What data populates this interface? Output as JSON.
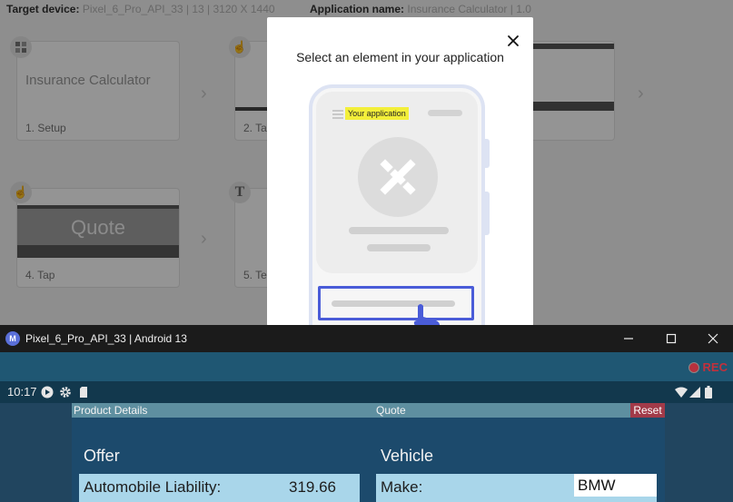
{
  "background": {
    "target_device_label": "Target device:",
    "target_device_value": "Pixel_6_Pro_API_33 | 13 | 3120 X 1440",
    "app_name_label": "Application name:",
    "app_name_value": "Insurance Calculator | 1.0",
    "cards": [
      {
        "caption": "1. Setup",
        "content": "Insurance Calculator"
      },
      {
        "caption": "2. Ta"
      },
      {
        "caption": "4. Tap",
        "content": "Quote"
      },
      {
        "caption": "5. Te"
      }
    ]
  },
  "modal": {
    "title": "Select an element in your application",
    "app_chip": "Your application"
  },
  "emulator": {
    "window_title": "Pixel_6_Pro_API_33 | Android 13",
    "logo_letter": "M",
    "rec_label": "REC",
    "clock": "10:17",
    "tabs": {
      "product_details": "Product Details",
      "quote": "Quote",
      "reset": "Reset"
    },
    "offer": {
      "title": "Offer",
      "label": "Automobile Liability:",
      "value": "319.66"
    },
    "vehicle": {
      "title": "Vehicle",
      "label": "Make:",
      "value": "BMW"
    }
  },
  "colors": {
    "accent": "#4a5cd8",
    "highlight": "#f3ef3a",
    "rec": "#c3303b",
    "reset": "#a23a49",
    "field_bg": "#a9d6ea"
  }
}
